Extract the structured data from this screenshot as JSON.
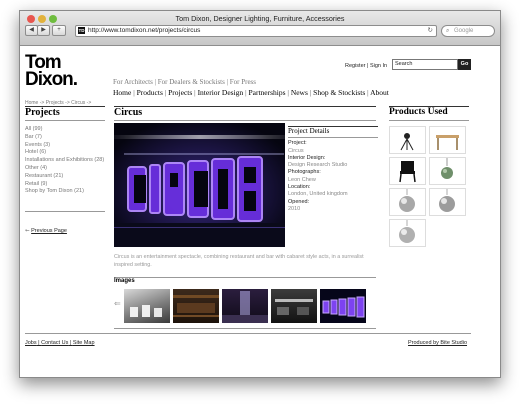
{
  "browser": {
    "window_title": "Tom Dixon, Designer Lighting, Furniture, Accessories",
    "back_label": "◀",
    "forward_label": "▶",
    "add_label": "+",
    "url": "http://www.tomdixon.net/projects/circus",
    "favicon_text": "TD",
    "reload_icon": "↻",
    "search_placeholder": "Google"
  },
  "header": {
    "logo_line1": "Tom",
    "logo_line2": "Dixon.",
    "register": "Register",
    "sign_in": "Sign In",
    "search_value": "Search",
    "go_label": "Go"
  },
  "topnav": {
    "sub": [
      "For Architects",
      "For Dealers & Stockists",
      "For Press"
    ],
    "main": [
      "Home",
      "Products",
      "Projects",
      "Interior Design",
      "Partnerships",
      "News",
      "Shop & Stockists",
      "About"
    ]
  },
  "breadcrumb": "Home -> Projects -> Circus ->",
  "sidebar": {
    "heading": "Projects",
    "items": [
      "All (99)",
      "Bar (7)",
      "Events (3)",
      "Hotel (6)",
      "Installations and Exhibitions (28)",
      "Other (4)",
      "Restaurant (21)",
      "Retail (9)",
      "Shop by Tom Dixon (21)"
    ],
    "prev_arrow": "⇽",
    "prev_label": "Previous Page"
  },
  "main": {
    "title": "Circus",
    "hero_text": "CIRCUS",
    "details_heading": "Project Details",
    "details": [
      {
        "label": "Project:",
        "value": "Circus"
      },
      {
        "label": "Interior Design:",
        "value": "Design Research Studio"
      },
      {
        "label": "Photographs:",
        "value": "Leon Chew"
      },
      {
        "label": "Location:",
        "value": "London, United kingdom"
      },
      {
        "label": "Opened:",
        "value": "2010"
      }
    ],
    "description": "Circus is an entertainment spectacle, combining restaurant and bar with cabaret style acts, in a surrealist inspired setting.",
    "images_heading": "Images",
    "images_prev": "⇐"
  },
  "products": {
    "heading": "Products Used"
  },
  "footer": {
    "links": [
      "Jobs",
      "Contact Us",
      "Site Map"
    ],
    "credit": "Produced by Bite Studio"
  },
  "colors": {
    "neon_purple": "#8a4cff",
    "hero_bg": "#050510"
  }
}
